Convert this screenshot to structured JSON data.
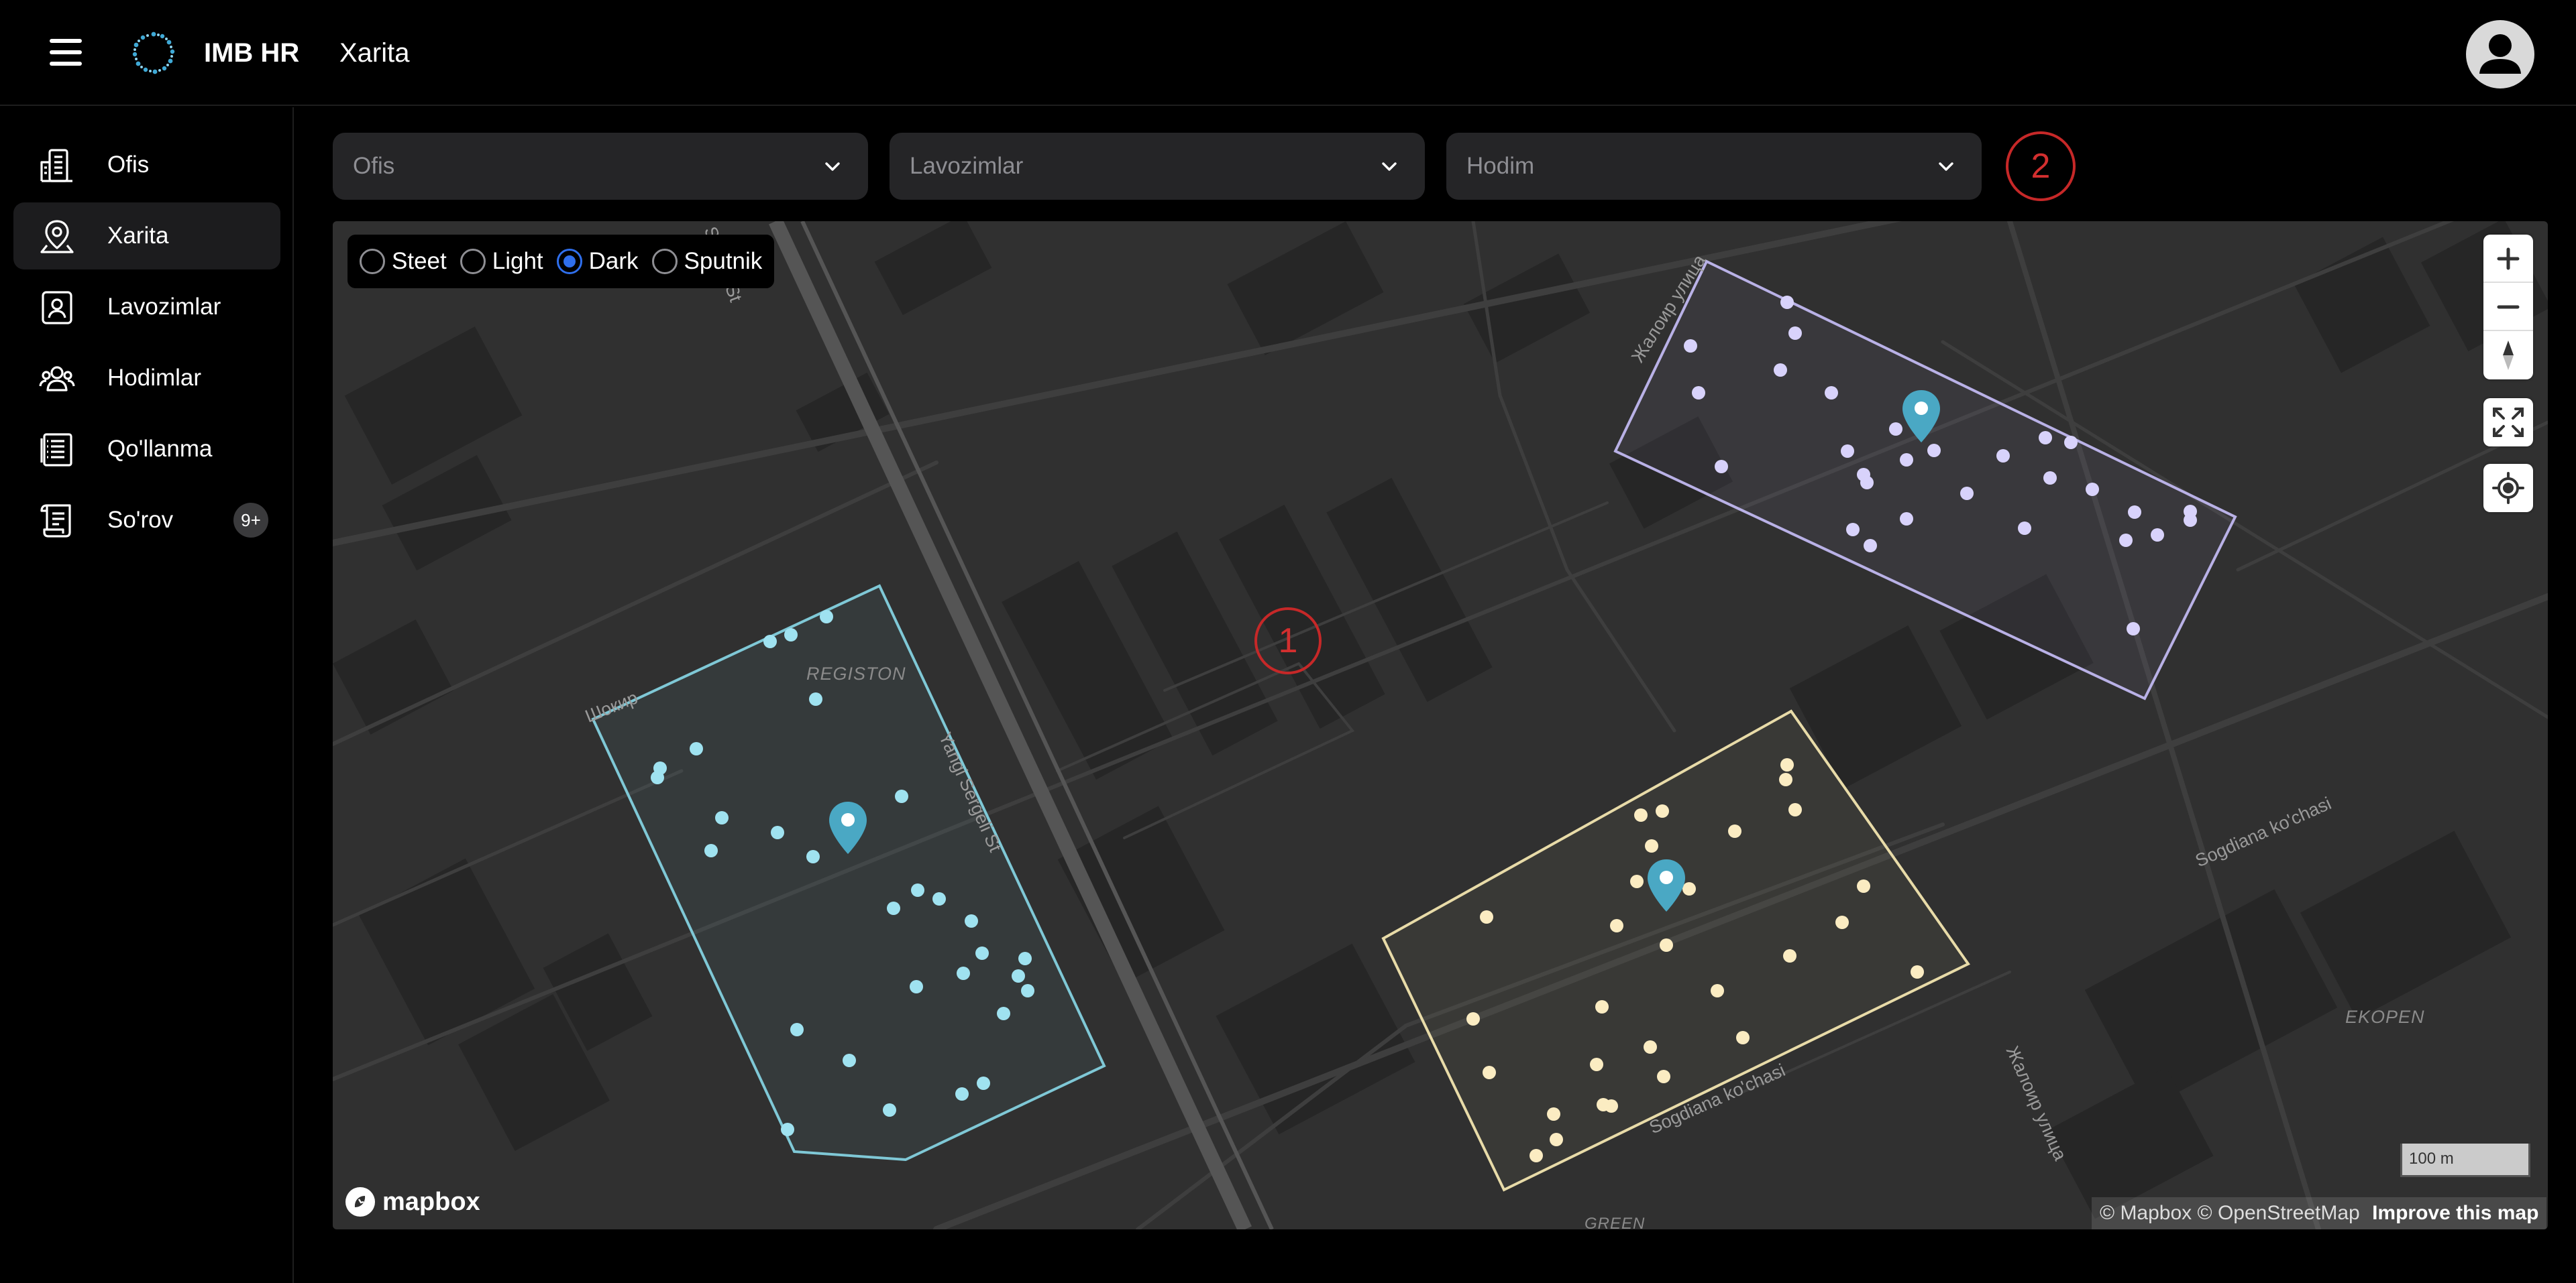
{
  "header": {
    "brand": "IMB HR",
    "title": "Xarita"
  },
  "sidebar": {
    "items": [
      {
        "label": "Ofis",
        "icon": "building-icon"
      },
      {
        "label": "Xarita",
        "icon": "map-pin-icon",
        "active": true
      },
      {
        "label": "Lavozimlar",
        "icon": "id-card-icon"
      },
      {
        "label": "Hodimlar",
        "icon": "users-icon"
      },
      {
        "label": "Qo'llanma",
        "icon": "manual-icon"
      },
      {
        "label": "So'rov",
        "icon": "scroll-icon",
        "badge": "9+"
      }
    ]
  },
  "filters": {
    "office": "Ofis",
    "positions": "Lavozimlar",
    "employee": "Hodim",
    "step_badge": "2"
  },
  "map": {
    "styles": [
      {
        "label": "Steet",
        "selected": false
      },
      {
        "label": "Light",
        "selected": false
      },
      {
        "label": "Dark",
        "selected": true
      },
      {
        "label": "Sputnik",
        "selected": false
      }
    ],
    "step_badge": "1",
    "logo": "mapbox",
    "scale": "100 m",
    "attribution": "© Mapbox © OpenStreetMap",
    "improve": "Improve this map",
    "labels": {
      "registon": "REGISTON",
      "yangi_sergeli": "Yangi Sergeli St",
      "sergeli_top": "Sergeli St",
      "shokir": "Шокир",
      "zhaloir_top": "Жалоир улица",
      "zhaloir_bottom": "Жалоир улица",
      "sogdiana_right": "Sogdiana ko'chasi",
      "sogdiana_bottom": "Sogdiana ko'chasi",
      "ekopen": "EKOPEN",
      "green": "GREEN"
    },
    "colors": {
      "zone_blue": "#7fc8d6",
      "zone_purple": "#b9b1e6",
      "zone_yellow": "#f2e3b3",
      "pin": "#4aa8c4",
      "radio_selected": "#2f6fed",
      "badge": "#d32f2f"
    }
  }
}
